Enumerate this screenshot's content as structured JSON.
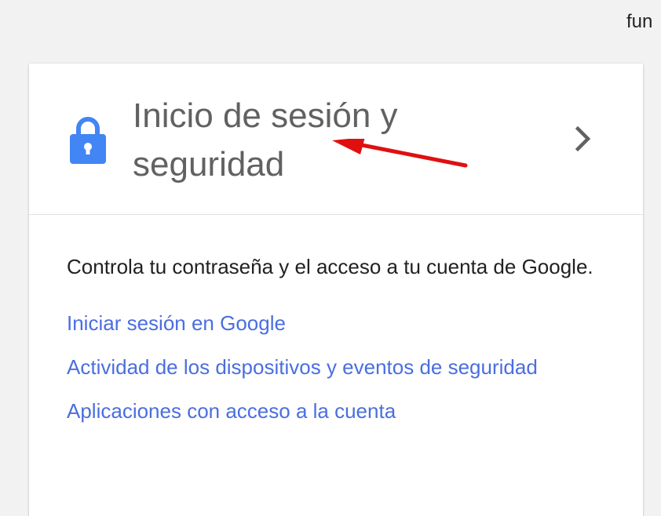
{
  "top_text": "fun",
  "card": {
    "title": "Inicio de sesión y seguridad",
    "description": "Controla tu contraseña y el acceso a tu cuenta de Google.",
    "links": [
      "Iniciar sesión en Google",
      "Actividad de los dispositivos y eventos de seguridad",
      "Aplicaciones con acceso a la cuenta"
    ]
  },
  "icons": {
    "lock": "lock-icon",
    "chevron": "chevron-right-icon",
    "annotation": "red-arrow-annotation"
  },
  "colors": {
    "accent": "#4285f4",
    "link": "#4a6ee0",
    "title": "#616161",
    "arrow": "#e01010"
  }
}
